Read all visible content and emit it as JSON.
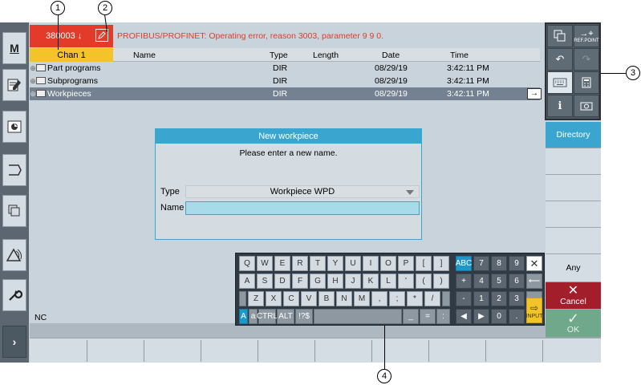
{
  "callouts": [
    "1",
    "2",
    "3",
    "4"
  ],
  "left_sidebar": {
    "items": [
      {
        "name": "machine",
        "label": "M"
      },
      {
        "name": "parameter",
        "label": ""
      },
      {
        "name": "program",
        "label": ""
      },
      {
        "name": "program-manager",
        "label": ""
      },
      {
        "name": "diagnostics",
        "label": ""
      },
      {
        "name": "setup",
        "label": ""
      },
      {
        "name": "tools",
        "label": ""
      },
      {
        "name": "more",
        "label": "›"
      }
    ]
  },
  "alarm": {
    "number": "380003",
    "arrow": "↓",
    "message": "PROFIBUS/PROFINET: Operating error, reason 3003, parameter 9 9 0."
  },
  "channel": "Chan 1",
  "table": {
    "columns": [
      "Name",
      "Type",
      "Length",
      "Date",
      "Time"
    ],
    "rows": [
      {
        "name": "Part programs",
        "type": "DIR",
        "length": "",
        "date": "08/29/19",
        "time": "3:42:11 PM"
      },
      {
        "name": "Subprograms",
        "type": "DIR",
        "length": "",
        "date": "08/29/19",
        "time": "3:42:11 PM"
      },
      {
        "name": "Workpieces",
        "type": "DIR",
        "length": "",
        "date": "08/29/19",
        "time": "3:42:11 PM"
      }
    ],
    "row_arrow": "→"
  },
  "dialog": {
    "title": "New workpiece",
    "message": "Please enter a new name.",
    "type_label": "Type",
    "type_value": "Workpiece WPD",
    "name_label": "Name",
    "name_value": ""
  },
  "status_line": "NC",
  "tool_buttons": {
    "ref_point_label": "REF.POINT",
    "info": "i"
  },
  "vertical_softkeys": {
    "directory": "Directory",
    "any": "Any",
    "cancel": "Cancel",
    "ok": "OK",
    "cancel_icon": "✕",
    "ok_icon": "✓"
  },
  "keyboard": {
    "row1": [
      "Q",
      "W",
      "E",
      "R",
      "T",
      "Y",
      "U",
      "I",
      "O",
      "P",
      "[",
      "]"
    ],
    "row2": [
      "A",
      "S",
      "D",
      "F",
      "G",
      "H",
      "J",
      "K",
      "L",
      "'",
      "(",
      ")"
    ],
    "row3": [
      "Z",
      "X",
      "C",
      "V",
      "B",
      "N",
      "M",
      ",",
      ";",
      "*",
      "/"
    ],
    "mods": [
      "A",
      "a",
      "CTRL",
      "ALT",
      "!?$",
      "_",
      "=",
      ":"
    ],
    "numpad": {
      "abc": "ABC",
      "row1": [
        "7",
        "8",
        "9"
      ],
      "row2": [
        "+",
        "4",
        "5",
        "6"
      ],
      "row3": [
        "-",
        "1",
        "2",
        "3"
      ],
      "row4": [
        "◀",
        "▶",
        "0",
        "."
      ],
      "close": "✕",
      "backspace": "⟵",
      "input_label": "INPUT",
      "input_icon": "⇨"
    }
  },
  "colors": {
    "accent": "#3aa6cf",
    "alarm": "#e23b2a",
    "channel": "#f3c42a",
    "cancel": "#a31e2b",
    "ok": "#6fa88a"
  }
}
